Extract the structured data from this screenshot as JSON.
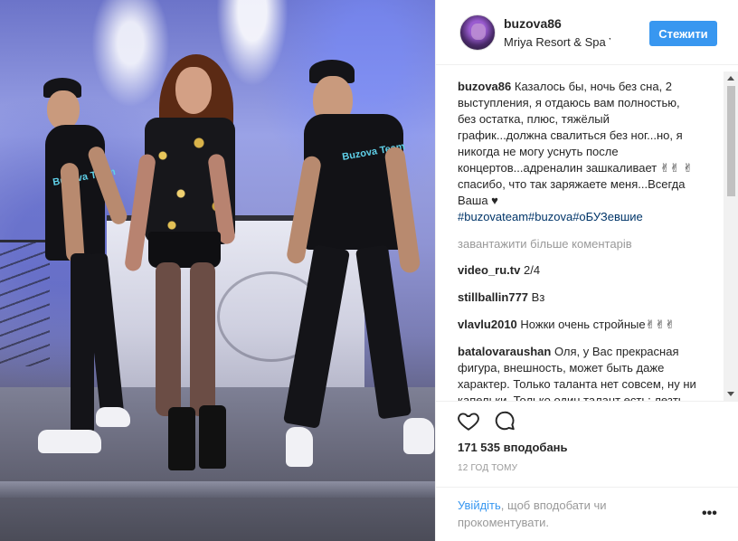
{
  "post": {
    "username": "buzova86",
    "location": "Mriya Resort & Spa Yalta",
    "follow_label": "Стежити",
    "caption": {
      "username": "buzova86",
      "text": "Казалось бы, ночь без сна, 2 выступления, я отдаюсь вам полностью, без остатка, плюс, тяжёлый график...должна свалиться без ног...но, я никогда не могу уснуть после концертов...адреналин зашкаливает ✌✌ ✌ спасибо, что так заряжаете меня...Всегда Ваша ♥",
      "hashtags": "#buzovateam#buzova#оБУЗевшие"
    },
    "load_more": "завантажити більше коментарів",
    "comments": [
      {
        "user": "video_ru.tv",
        "text": "2/4"
      },
      {
        "user": "stillballin777",
        "text": "Вз"
      },
      {
        "user": "vlavlu2010",
        "text": "Ножки очень стройные✌✌✌"
      },
      {
        "user": "batalovaraushan",
        "text": "Оля, у Вас прекрасная фигура, внешность, может быть даже характер. Только таланта нет совсем, ну ни капельки. Только один талант есть: лезть напролом. Вы такую же безвкусицу"
      }
    ],
    "likes": "171 535 вподобань",
    "time": "12 ГОД ТОМУ",
    "login_link": "Увійдіть",
    "login_rest": ", щоб вподобати чи прокоментувати.",
    "more_label": "•••"
  },
  "photo": {
    "tee_text": "Buzova Team"
  },
  "icons": {
    "like": "heart-icon",
    "comment": "comment-icon",
    "more": "more-icon"
  },
  "colors": {
    "follow_button": "#3897f0",
    "hashtag": "#003569",
    "muted": "#999999"
  }
}
